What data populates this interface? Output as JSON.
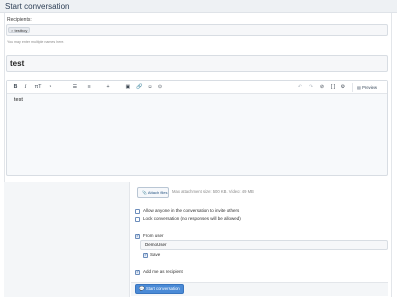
{
  "page": {
    "title": "Start conversation"
  },
  "recipients": {
    "label": "Recipients:",
    "token": "testboy",
    "token_remove": "×",
    "hint": "You may enter multiple names here."
  },
  "title_field": {
    "value": "test"
  },
  "editor": {
    "content": "test",
    "toolbar": {
      "bold": "B",
      "italic": "I",
      "text_style": "πT",
      "paint": "◔",
      "list": "☰",
      "align": "≡",
      "insert": "+",
      "image": "▣",
      "link": "🔗",
      "smilie": "☺",
      "media": "⊙",
      "more": "▤",
      "undo": "↶",
      "redo": "↷",
      "remove_format": "⊘",
      "source": "[ ]",
      "settings": "⚙"
    },
    "preview_label": "Preview"
  },
  "attachments": {
    "button_label": "Attach files",
    "note": "Max attachment size: 500 KB. Video: 49 MB"
  },
  "options": {
    "allow_invite": {
      "label": "Allow anyone in the conversation to invite others",
      "checked": false
    },
    "lock": {
      "label": "Lock conversation (no responses will be allowed)",
      "checked": false
    },
    "from_user": {
      "label": "From user",
      "checked": true,
      "value": "DemoUser"
    },
    "save": {
      "label": "Save",
      "checked": true
    },
    "add_me": {
      "label": "Add me as recipient",
      "checked": true
    }
  },
  "submit": {
    "label": "Start conversation",
    "icon": "chat-bubbles-icon"
  },
  "colors": {
    "accent": "#4a8ad6",
    "header_bg": "#eef1f4",
    "title": "#2c3e55"
  }
}
